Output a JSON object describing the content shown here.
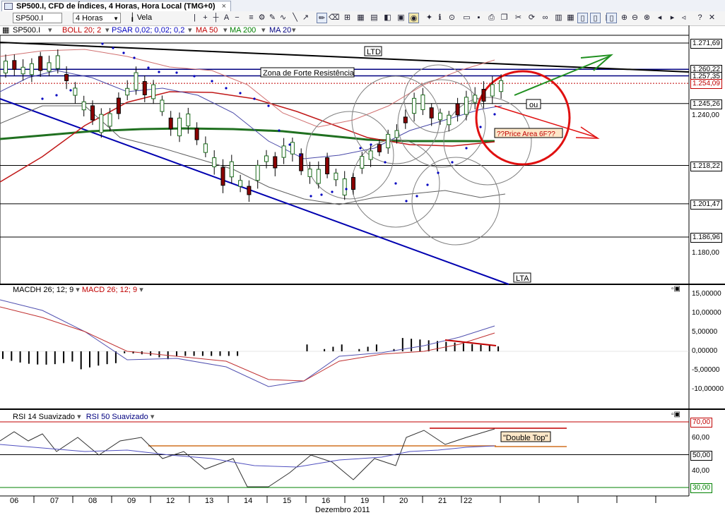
{
  "window": {
    "tab_title": "SP500.I, CFD de Índices, 4 Horas, Hora Local (TMG+0)",
    "tab_close": "×"
  },
  "toolbar": {
    "symbol": "SP500.I",
    "timeframe": "4 Horas",
    "chart_type": "Vela",
    "icons": [
      "cursor-icon",
      "crosshair-icon",
      "draw-line-icon",
      "text-icon",
      "zoom-in-icon",
      "zoom-out-icon",
      "save-icon",
      "print-icon",
      "settings-icon",
      "window-icon"
    ]
  },
  "legend": {
    "symbol": "SP500.I",
    "boll": "BOLL 20; 2",
    "psar": "PSAR 0,02; 0,02; 0,2",
    "ma50": "MA 50",
    "ma200": "MA 200",
    "ma20": "MA 20",
    "colors": {
      "boll": "#c00000",
      "psar": "#0000c0",
      "ma50": "#c00000",
      "ma200": "#008000",
      "ma20": "#000080"
    }
  },
  "annotations": {
    "ltd": "LTD",
    "lta": "LTA",
    "resistance_zone": "Zona de Forte Resistência",
    "ou": "ou",
    "price_area": "??Price Area 6F??",
    "double_top": "\"Double Top\""
  },
  "price_axis": {
    "tick_labels": [
      "1.240,00",
      "1.180,00"
    ],
    "badges": [
      {
        "label": "1.271,69",
        "kind": "level"
      },
      {
        "label": "1.260,22",
        "kind": "level"
      },
      {
        "label": "1.257,35",
        "kind": "level"
      },
      {
        "label": "1.254,09",
        "kind": "current"
      },
      {
        "label": "1.245,26",
        "kind": "level"
      },
      {
        "label": "1.218,22",
        "kind": "level"
      },
      {
        "label": "1.201,47",
        "kind": "level"
      },
      {
        "label": "1.186,96",
        "kind": "level"
      }
    ]
  },
  "macd_panel": {
    "histogram_label": "MACDH 26; 12; 9",
    "macd_label": "MACD 26; 12; 9",
    "tick_labels": [
      "15,00000",
      "10,00000",
      "5,00000",
      "0,00000",
      "-5,00000",
      "-10,00000"
    ]
  },
  "rsi_panel": {
    "rsi14_label": "RSI 14 Suavizado",
    "rsi50_label": "RSI 50 Suavizado",
    "tick_labels": [
      "60,00",
      "40,00"
    ],
    "badges": [
      "70,00",
      "50,00",
      "30,00"
    ]
  },
  "time_axis": {
    "day_labels": [
      "06",
      "07",
      "08",
      "09",
      "12",
      "13",
      "14",
      "15",
      "16",
      "19",
      "20",
      "21",
      "22"
    ],
    "month_label": "Dezembro 2011"
  },
  "chart_data": {
    "type": "candlestick",
    "symbol": "SP500.I",
    "timeframe": "4 Horas",
    "x_categories": [
      "06",
      "07",
      "08",
      "09",
      "12",
      "13",
      "14",
      "15",
      "16",
      "19",
      "20",
      "21",
      "22"
    ],
    "price_levels": [
      1271.69,
      1260.22,
      1257.35,
      1254.09,
      1245.26,
      1218.22,
      1201.47,
      1186.96
    ],
    "y_ticks": [
      1240.0,
      1180.0
    ],
    "macd_ticks": [
      15,
      10,
      5,
      0,
      -5,
      -10
    ],
    "rsi_levels": [
      70,
      50,
      30
    ],
    "rsi_ticks": [
      60,
      40
    ]
  }
}
